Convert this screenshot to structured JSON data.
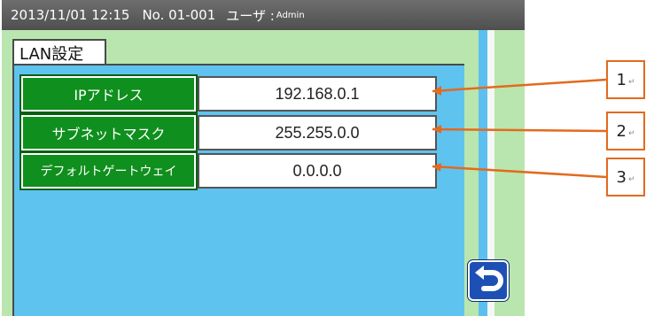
{
  "header": {
    "datetime": "2013/11/01  12:15",
    "number": "No. 01-001",
    "user_label": "ユーザ :",
    "user_value": "Admin"
  },
  "tab": {
    "label": "LAN設定"
  },
  "settings": [
    {
      "label": "IPアドレス",
      "value": "192.168.0.1"
    },
    {
      "label": "サブネットマスク",
      "value": "255.255.0.0"
    },
    {
      "label": "デフォルトゲートウェイ",
      "value": "0.0.0.0"
    }
  ],
  "back_button": {
    "icon": "return-arrow-icon"
  },
  "callouts": [
    {
      "number": "1",
      "mark": "↵"
    },
    {
      "number": "2",
      "mark": "↵"
    },
    {
      "number": "3",
      "mark": "↵"
    }
  ],
  "colors": {
    "header": "#5a5a5a",
    "panel": "#5fc3f0",
    "label_green": "#0f8f1d",
    "callout": "#e36a1e",
    "back_button": "#1e4fb4"
  }
}
